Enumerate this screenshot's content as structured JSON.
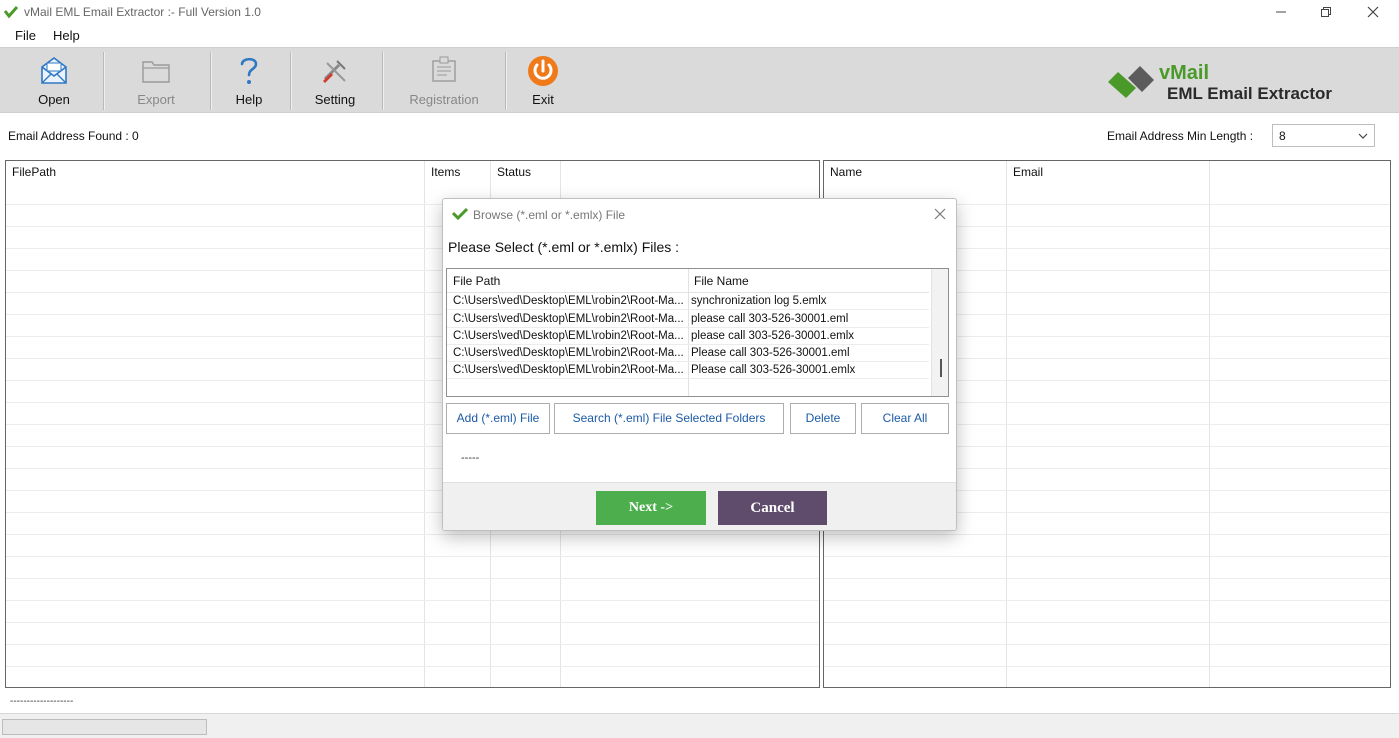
{
  "window": {
    "title": "vMail EML Email Extractor :- Full Version 1.0",
    "controls": [
      "minimize-icon",
      "restore-icon",
      "close-icon"
    ]
  },
  "menu": {
    "items": [
      "File",
      "Help"
    ]
  },
  "toolbar": {
    "buttons": [
      {
        "label": "Open",
        "icon": "open-mail-icon",
        "enabled": true
      },
      {
        "label": "Export",
        "icon": "export-icon",
        "enabled": false
      },
      {
        "label": "Help",
        "icon": "question-mark-icon",
        "enabled": true
      },
      {
        "label": "Setting",
        "icon": "tools-icon",
        "enabled": true
      },
      {
        "label": "Registration",
        "icon": "registration-icon",
        "enabled": false
      },
      {
        "label": "Exit",
        "icon": "power-icon",
        "enabled": true
      }
    ],
    "brand": {
      "name": "vMail",
      "subtitle": "EML Email Extractor",
      "color": "#4a9a2a"
    }
  },
  "info": {
    "found_label": "Email Address Found :  0",
    "min_length_label": "Email Address Min Length :",
    "min_length_value": "8"
  },
  "left_grid": {
    "columns": [
      "FilePath",
      "Items",
      "Status"
    ]
  },
  "right_grid": {
    "columns": [
      "Name",
      "Email"
    ]
  },
  "status": {
    "text": "-------------------",
    "progress": 0
  },
  "dialog": {
    "title": "Browse (*.eml or *.emlx) File",
    "prompt": "Please Select (*.eml or *.emlx) Files :",
    "columns": [
      "File Path",
      "File Name"
    ],
    "rows": [
      {
        "path": "C:\\Users\\ved\\Desktop\\EML\\robin2\\Root-Ma...",
        "name": "synchronization log 5.emlx"
      },
      {
        "path": "C:\\Users\\ved\\Desktop\\EML\\robin2\\Root-Ma...",
        "name": "please call 303-526-30001.eml"
      },
      {
        "path": "C:\\Users\\ved\\Desktop\\EML\\robin2\\Root-Ma...",
        "name": "please call 303-526-30001.emlx"
      },
      {
        "path": "C:\\Users\\ved\\Desktop\\EML\\robin2\\Root-Ma...",
        "name": "Please call 303-526-30001.eml"
      },
      {
        "path": "C:\\Users\\ved\\Desktop\\EML\\robin2\\Root-Ma...",
        "name": "Please call 303-526-30001.emlx"
      }
    ],
    "buttons": {
      "add": "Add (*.eml) File",
      "search": "Search (*.eml) File Selected Folders",
      "delete": "Delete",
      "clear": "Clear All"
    },
    "status_text": "-----",
    "next": "Next  ->",
    "cancel": "Cancel",
    "colors": {
      "next": "#4cae4c",
      "cancel": "#5f4b6b"
    }
  }
}
